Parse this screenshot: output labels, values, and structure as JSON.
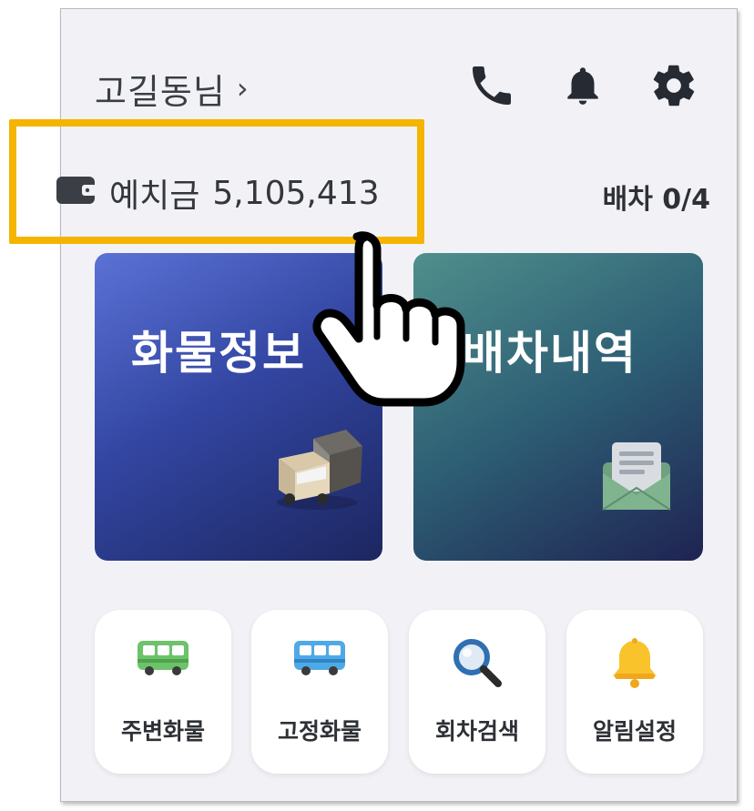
{
  "header": {
    "user_name": "고길동님",
    "chevron": "›",
    "icons": [
      "phone-icon",
      "bell-icon",
      "gear-icon"
    ]
  },
  "balance": {
    "label": "예치금",
    "amount": "5,105,413",
    "icon": "wallet-icon"
  },
  "dispatch_count": "배차 0/4",
  "cards": [
    {
      "title": "화물정보",
      "icon": "truck-icon"
    },
    {
      "title": "배차내역",
      "icon": "envelope-icon"
    }
  ],
  "quick_menu": [
    {
      "label": "주변화물",
      "icon": "green-bus-icon"
    },
    {
      "label": "고정화물",
      "icon": "blue-bus-icon"
    },
    {
      "label": "회차검색",
      "icon": "magnifier-icon"
    },
    {
      "label": "알림설정",
      "icon": "yellow-bell-icon"
    }
  ],
  "colors": {
    "highlight": "#f4b400",
    "cargo_card": "#3346a2",
    "dispatch_card": "#2d5e74"
  }
}
